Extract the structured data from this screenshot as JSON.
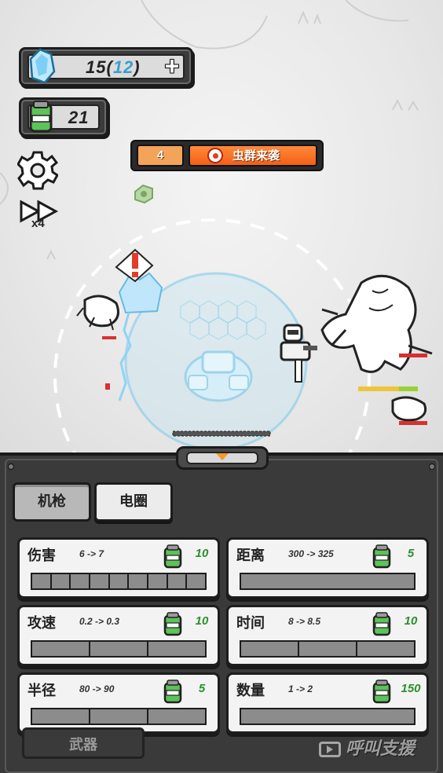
{
  "hud": {
    "crystals": "15",
    "crystals_max_open": "(",
    "crystals_max": "12",
    "crystals_max_close": ")",
    "add_label": "+",
    "energy": "21",
    "speed_label": "x4"
  },
  "wave": {
    "number": "4",
    "title": "虫群来袭"
  },
  "tabs": [
    {
      "label": "机枪",
      "active": true
    },
    {
      "label": "电圈",
      "active": false
    }
  ],
  "upgrades": [
    {
      "name": "伤害",
      "change": "6 -> 7",
      "cost": "10",
      "segments": 9,
      "filled": 0
    },
    {
      "name": "距离",
      "change": "300 -> 325",
      "cost": "5",
      "segments": 1,
      "filled": 0
    },
    {
      "name": "攻速",
      "change": "0.2 -> 0.3",
      "cost": "10",
      "segments": 3,
      "filled": 0
    },
    {
      "name": "时间",
      "change": "8 -> 8.5",
      "cost": "10",
      "segments": 3,
      "filled": 0
    },
    {
      "name": "半径",
      "change": "80 -> 90",
      "cost": "5",
      "segments": 3,
      "filled": 0
    },
    {
      "name": "数量",
      "change": "1 -> 2",
      "cost": "150",
      "segments": 1,
      "filled": 0
    }
  ],
  "bottom": {
    "weapon_label": "武器",
    "call_support_label": "呼叫支援"
  },
  "colors": {
    "accent_orange": "#f35f14",
    "cost_green": "#2b8f2b",
    "crystal_blue": "#3b9fcf"
  }
}
